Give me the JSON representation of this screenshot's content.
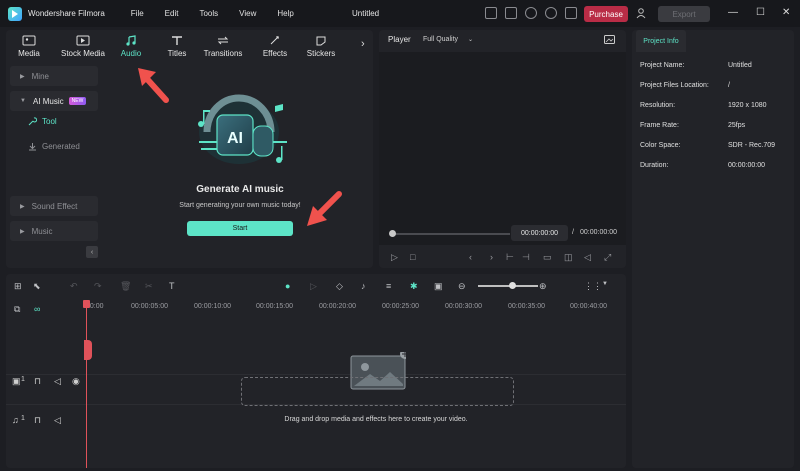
{
  "app": {
    "name": "Wondershare Filmora",
    "menu": [
      "File",
      "Edit",
      "Tools",
      "View",
      "Help"
    ],
    "document_title": "Untitled",
    "purchase_label": "Purchase",
    "export_label": "Export",
    "accent_color": "#5de4c7",
    "purchase_color": "#b92c46"
  },
  "media_tabs": [
    {
      "label": "Media",
      "icon": "media-icon"
    },
    {
      "label": "Stock Media",
      "icon": "stock-media-icon"
    },
    {
      "label": "Audio",
      "icon": "music-note-icon",
      "active": true
    },
    {
      "label": "Titles",
      "icon": "titles-icon"
    },
    {
      "label": "Transitions",
      "icon": "transitions-icon"
    },
    {
      "label": "Effects",
      "icon": "effects-icon"
    },
    {
      "label": "Stickers",
      "icon": "stickers-icon"
    }
  ],
  "sidebar": {
    "mine": "Mine",
    "ai_music": "AI Music",
    "new_badge": "NEW",
    "tool": "Tool",
    "generated": "Generated",
    "sound_effect": "Sound Effect",
    "music": "Music"
  },
  "content": {
    "art_label": "AI",
    "title": "Generate AI music",
    "subtitle": "Start generating your own music today!",
    "start_label": "Start"
  },
  "player": {
    "label": "Player",
    "quality": "Full Quality",
    "current_time": "00:00:00:00",
    "separator": "/",
    "total_time": "00:00:00:00"
  },
  "project_info": {
    "tab_label": "Project Info",
    "rows": [
      {
        "key": "Project Name:",
        "value": "Untitled"
      },
      {
        "key": "Project Files Location:",
        "value": "/"
      },
      {
        "key": "Resolution:",
        "value": "1920 x 1080"
      },
      {
        "key": "Frame Rate:",
        "value": "25fps"
      },
      {
        "key": "Color Space:",
        "value": "SDR - Rec.709"
      },
      {
        "key": "Duration:",
        "value": "00:00:00:00"
      }
    ]
  },
  "timeline": {
    "ruler": [
      "00:00",
      "00:00:05:00",
      "00:00:10:00",
      "00:00:15:00",
      "00:00:20:00",
      "00:00:25:00",
      "00:00:30:00",
      "00:00:35:00",
      "00:00:40:00"
    ],
    "video_track_number": "1",
    "audio_track_number": "1",
    "drop_text": "Drag and drop media and effects here to create your video."
  }
}
